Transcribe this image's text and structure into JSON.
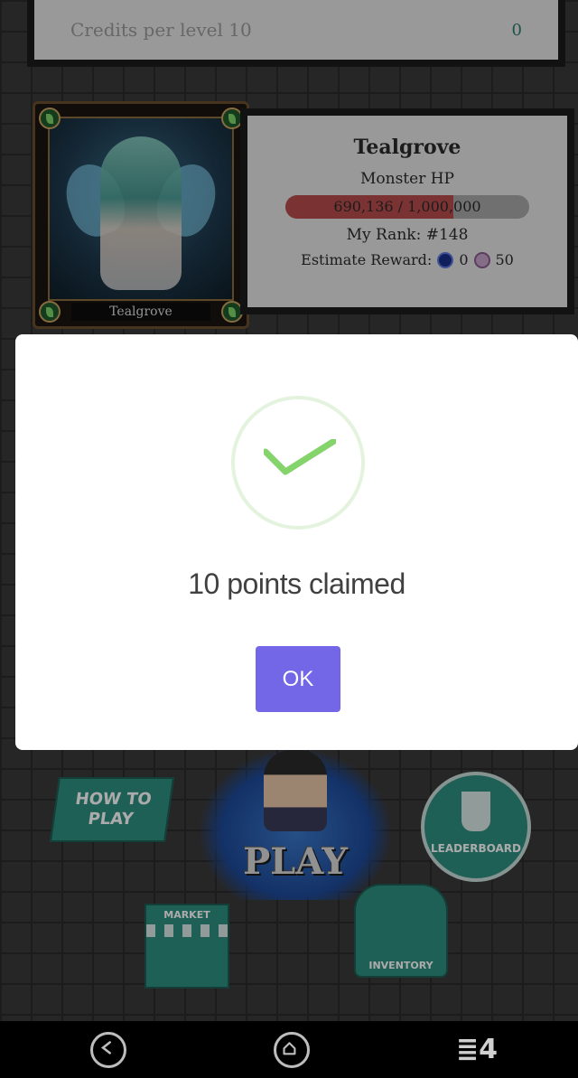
{
  "background": {
    "credits": {
      "label": "Credits per level 10",
      "value": "0"
    },
    "boss": {
      "card_name": "Tealgrove",
      "name": "Tealgrove",
      "hp_label": "Monster HP",
      "hp_text": "690,136 / 1,000,000",
      "hp_current": 690136,
      "hp_max": 1000000,
      "rank": "My Rank: #148",
      "reward_label": "Estimate Reward:",
      "reward_steem": "0",
      "reward_token": "50"
    },
    "menu": {
      "how_to_play": "HOW TO PLAY",
      "play": "PLAY",
      "leaderboard": "LEADERBOARD",
      "market": "MARKET",
      "inventory": "INVENTORY"
    }
  },
  "modal": {
    "title": "10 points claimed",
    "ok_label": "OK",
    "success_color": "#84d36b",
    "button_color": "#7367e8"
  },
  "nav_bar": {
    "recents_label": "≣4",
    "icons": [
      "back-icon",
      "home-icon",
      "recents-icon"
    ]
  }
}
